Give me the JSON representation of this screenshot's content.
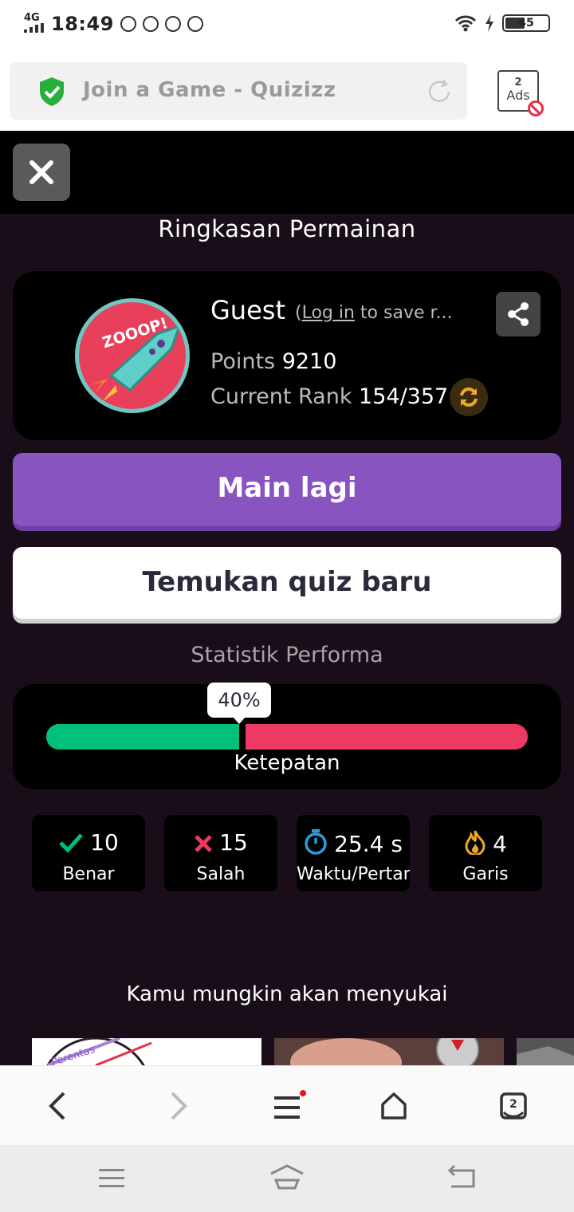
{
  "status_bar": {
    "network": "4G",
    "time": "18:49",
    "battery": "45"
  },
  "browser": {
    "tab_title": "Join a Game - Quizizz",
    "ads_count": "2",
    "ads_label": "Ads"
  },
  "summary": {
    "title": "Ringkasan Permainan",
    "player_name": "Guest",
    "login_prefix": "(",
    "login_link": "Log in",
    "login_suffix": " to save r...",
    "points_label": "Points",
    "points_value": "9210",
    "rank_label": "Current Rank",
    "rank_value": "154/357",
    "avatar_text": "ZOOOP!"
  },
  "buttons": {
    "play_again": "Main lagi",
    "find_quiz": "Temukan quiz baru"
  },
  "stats": {
    "title": "Statistik Performa",
    "accuracy_percent": 40,
    "accuracy_label": "40%",
    "accuracy_caption": "Ketepatan",
    "items": [
      {
        "value": "10",
        "label": "Benar",
        "icon": "check-icon",
        "color": "#00c07a"
      },
      {
        "value": "15",
        "label": "Salah",
        "icon": "x-icon",
        "color": "#ec3a62"
      },
      {
        "value": "25.4 s",
        "label": "Waktu/Pertanyaan",
        "icon": "timer-icon",
        "color": "#2d9cdb"
      },
      {
        "value": "4",
        "label": "Garis",
        "icon": "flame-icon",
        "color": "#efa929"
      }
    ]
  },
  "suggestions": {
    "title": "Kamu mungkin akan menyukai",
    "card1_text": "Perentas"
  },
  "colors": {
    "primary": "#8854c0",
    "correct": "#00c07a",
    "incorrect": "#ec3a62",
    "background": "#1a0d1a"
  }
}
